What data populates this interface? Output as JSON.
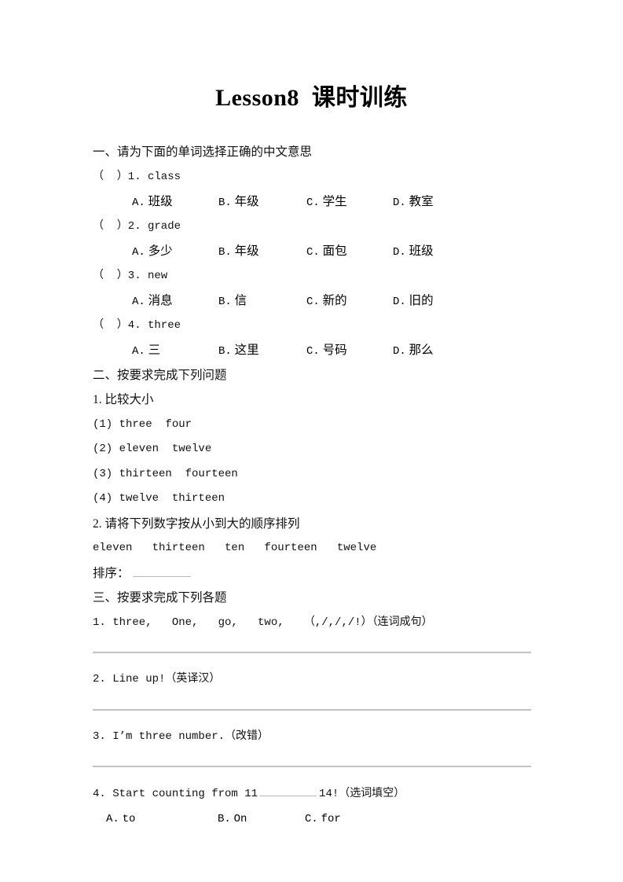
{
  "document": {
    "title": "Lesson8  课时训练"
  },
  "sections": [
    {
      "heading": "一、请为下面的单词选择正确的中文意思",
      "questions": [
        {
          "stem": "（  ）1. class",
          "bracket": "（  ）",
          "number": "1.",
          "word": "class",
          "options": [
            {
              "label": "A.",
              "value": "班级"
            },
            {
              "label": "B.",
              "value": "年级"
            },
            {
              "label": "C.",
              "value": "学生"
            },
            {
              "label": "D.",
              "value": "教室"
            }
          ]
        },
        {
          "stem": "（  ）2. grade",
          "bracket": "（  ）",
          "number": "2.",
          "word": "grade",
          "options": [
            {
              "label": "A.",
              "value": "多少"
            },
            {
              "label": "B.",
              "value": "年级"
            },
            {
              "label": "C.",
              "value": "面包"
            },
            {
              "label": "D.",
              "value": "班级"
            }
          ]
        },
        {
          "stem": "（  ）3. new",
          "bracket": "（  ）",
          "number": "3.",
          "word": "new",
          "options": [
            {
              "label": "A.",
              "value": "消息"
            },
            {
              "label": "B.",
              "value": "信"
            },
            {
              "label": "C.",
              "value": "新的"
            },
            {
              "label": "D.",
              "value": "旧的"
            }
          ]
        },
        {
          "stem": "（  ）4. three",
          "bracket": "（  ）",
          "number": "4.",
          "word": "three",
          "options": [
            {
              "label": "A.",
              "value": "三"
            },
            {
              "label": "B.",
              "value": "这里"
            },
            {
              "label": "C.",
              "value": "号码"
            },
            {
              "label": "D.",
              "value": "那么"
            }
          ]
        }
      ]
    },
    {
      "heading": "二、按要求完成下列问题",
      "task1_title": "1. 比较大小",
      "compare_items": [
        "(1) three  four",
        "(2) eleven  twelve",
        "(3) thirteen  fourteen",
        "(4) twelve  thirteen"
      ],
      "task2_title": "2. 请将下列数字按从小到大的顺序排列",
      "task2_words": "eleven   thirteen   ten   fourteen   twelve",
      "task2_answer_label": "排序："
    },
    {
      "heading": "三、按要求完成下列各题",
      "items": [
        {
          "number": "1.",
          "text": "three,   One,   go,   two,   （,/,/,/!）（连词成句）"
        },
        {
          "number": "2.",
          "text": "Line up!（英译汉）"
        },
        {
          "number": "3.",
          "text": "I’m three number.（改错）"
        },
        {
          "number": "4.",
          "text_before": "4. Start counting from 11",
          "text_after": "14!（选词填空）",
          "options": [
            {
              "label": "A.",
              "value": "to"
            },
            {
              "label": "B.",
              "value": "On"
            },
            {
              "label": "C.",
              "value": "for"
            }
          ]
        }
      ]
    }
  ]
}
